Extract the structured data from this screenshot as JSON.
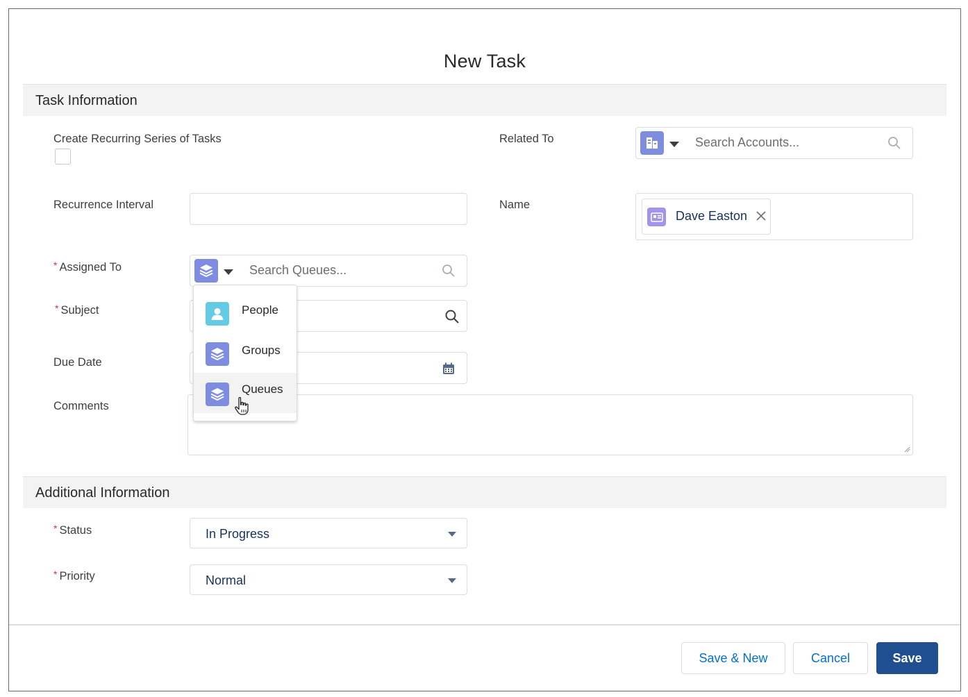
{
  "modal": {
    "title": "New Task"
  },
  "sections": {
    "task_info": "Task Information",
    "additional_info": "Additional Information"
  },
  "fields": {
    "recurring": {
      "label": "Create Recurring Series of Tasks",
      "checked": false
    },
    "recurrence_interval": {
      "label": "Recurrence Interval",
      "value": ""
    },
    "assigned_to": {
      "label": "Assigned To",
      "required": "*",
      "placeholder": "Search Queues..."
    },
    "subject": {
      "label": "Subject",
      "required": "*"
    },
    "due_date": {
      "label": "Due Date"
    },
    "comments": {
      "label": "Comments"
    },
    "related_to": {
      "label": "Related To",
      "placeholder": "Search Accounts..."
    },
    "name": {
      "label": "Name",
      "pill": "Dave Easton"
    },
    "status": {
      "label": "Status",
      "required": "*",
      "value": "In Progress"
    },
    "priority": {
      "label": "Priority",
      "required": "*",
      "value": "Normal"
    }
  },
  "dropdown": {
    "items": [
      {
        "label": "People",
        "icon": "person-icon"
      },
      {
        "label": "Groups",
        "icon": "stack-icon"
      },
      {
        "label": "Queues",
        "icon": "stack-icon",
        "hovered": true
      }
    ]
  },
  "footer": {
    "save_new": "Save & New",
    "cancel": "Cancel",
    "save": "Save"
  },
  "colors": {
    "accent_icon": "#7f8de1",
    "brand_button": "#1f4f8f",
    "required": "#c23934",
    "account_icon": "#7f8de1",
    "contact_icon": "#a094ed",
    "people_icon": "#65cae4"
  }
}
